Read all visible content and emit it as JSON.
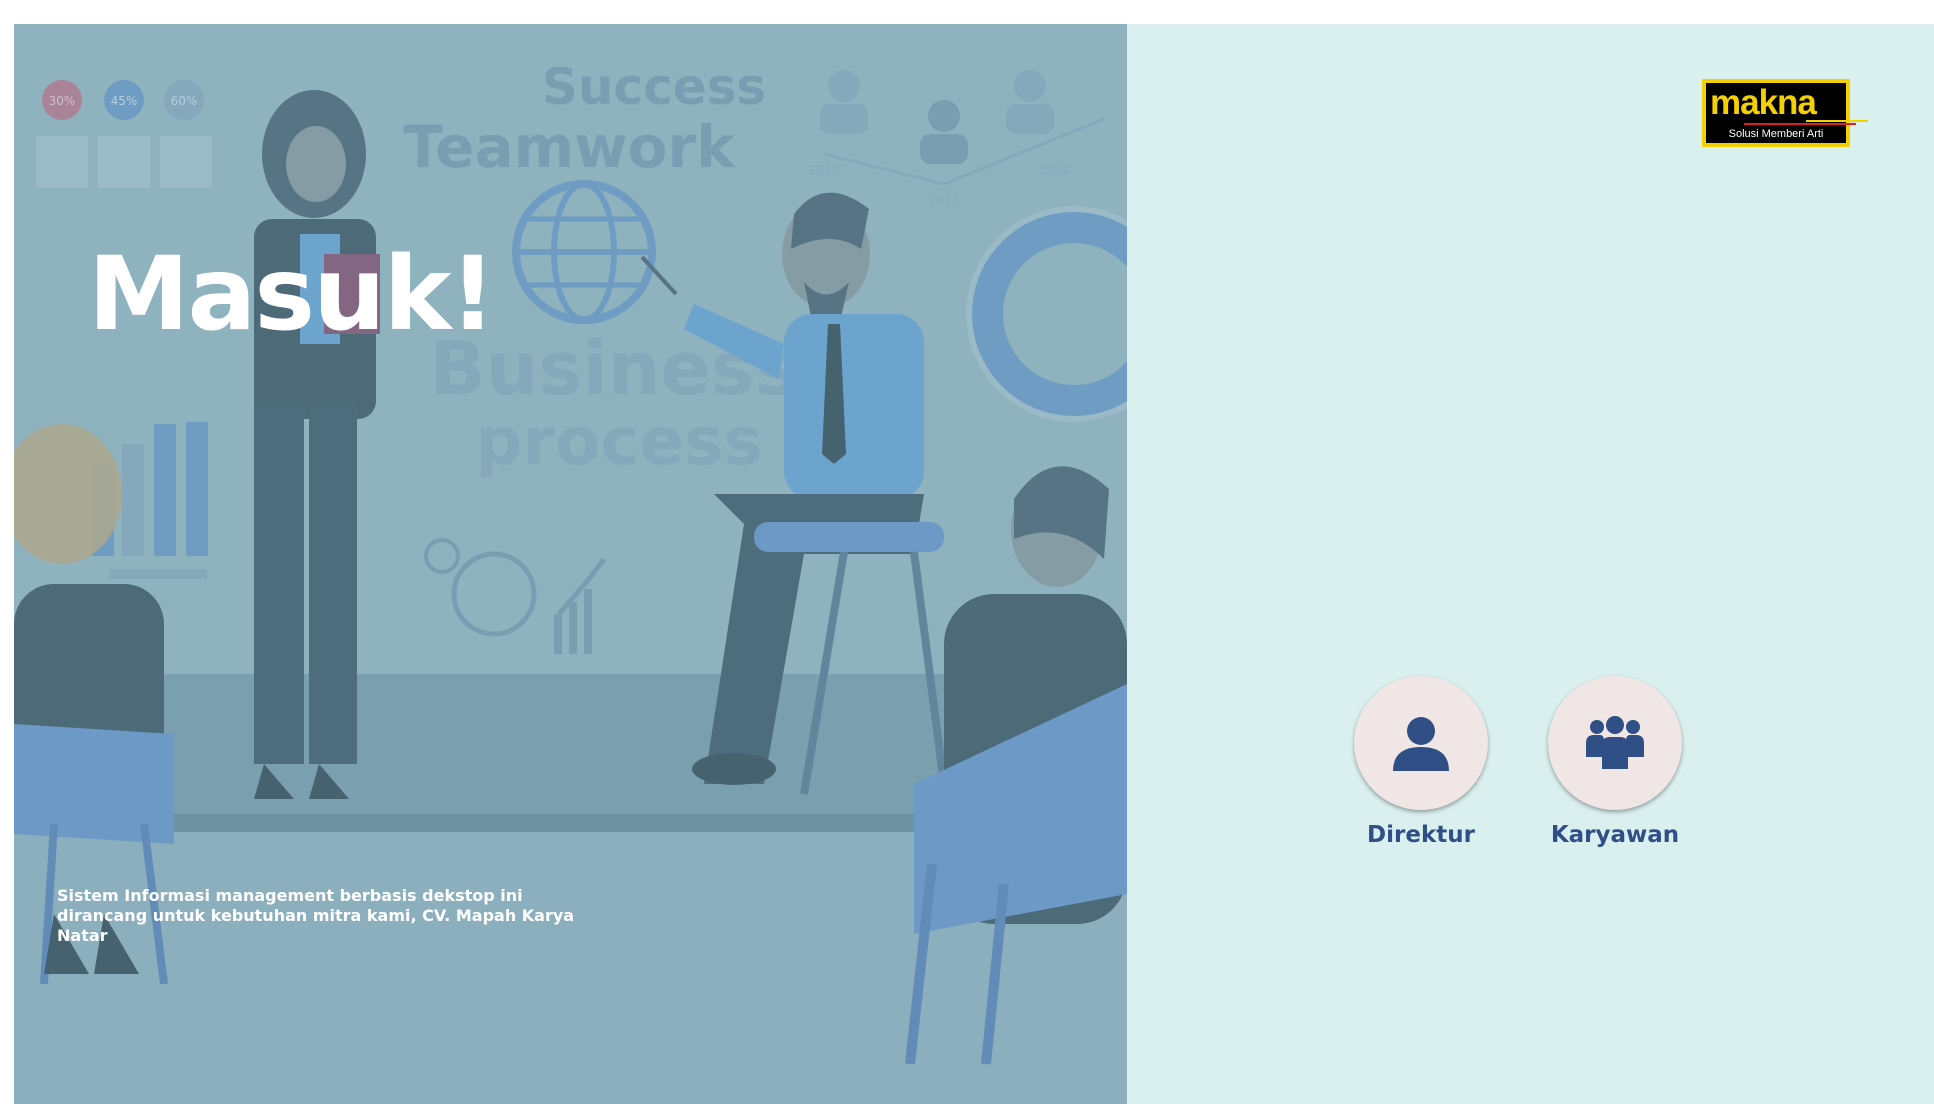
{
  "hero": {
    "title": "Masuk!",
    "description": "Sistem Informasi management berbasis dekstop ini dirancang untuk kebutuhan mitra kami, CV. Mapah Karya Natar"
  },
  "illustration": {
    "board_heading_1": "Success",
    "board_heading_2": "Teamwork",
    "board_heading_3": "Business",
    "board_heading_4": "process",
    "stat_1": "30%",
    "stat_2": "45%",
    "stat_3": "60%",
    "year_1": "2010",
    "year_2": "2012",
    "year_3": "2014"
  },
  "logo": {
    "word": "makna",
    "tagline": "Solusi Memberi Arti"
  },
  "roles": [
    {
      "label": "Direktur",
      "icon": "user-icon"
    },
    {
      "label": "Karyawan",
      "icon": "users-group-icon"
    }
  ],
  "colors": {
    "left_panel": "#87a9b7",
    "right_panel": "#daf0ef",
    "accent_blue": "#2f4f86",
    "logo_yellow": "#f5d000"
  }
}
